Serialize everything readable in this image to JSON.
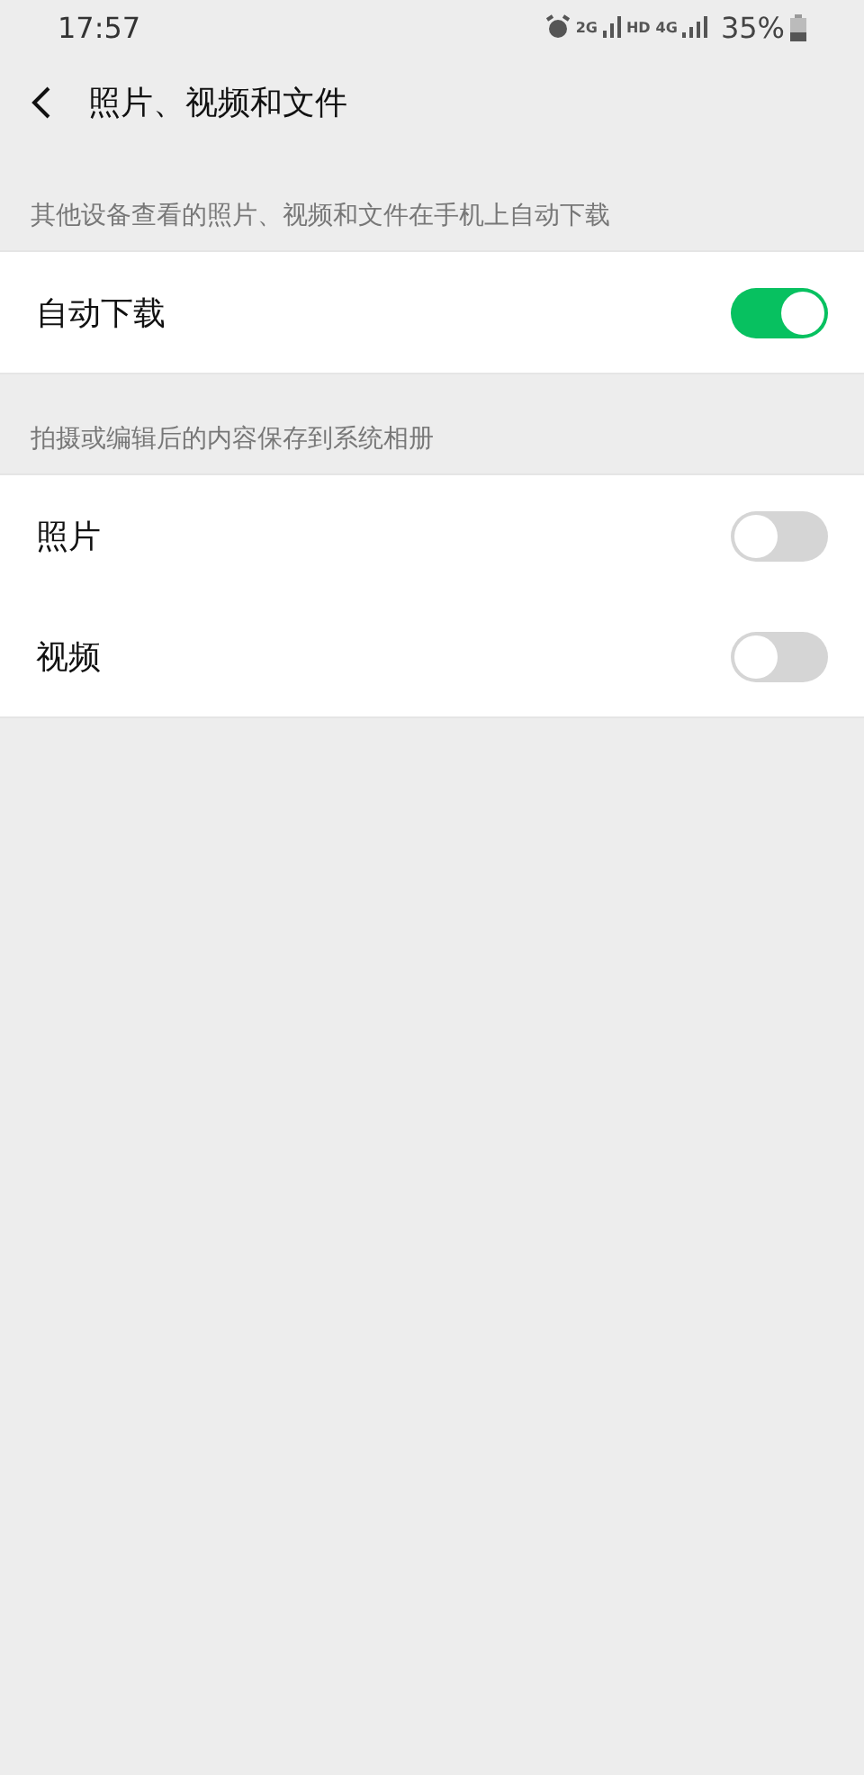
{
  "status_bar": {
    "time": "17:57",
    "network_1": "2G",
    "hd": "HD",
    "network_2": "4G",
    "battery": "35%"
  },
  "header": {
    "title": "照片、视频和文件"
  },
  "sections": [
    {
      "caption": "其他设备查看的照片、视频和文件在手机上自动下载",
      "items": [
        {
          "label": "自动下载",
          "on": true
        }
      ]
    },
    {
      "caption": "拍摄或编辑后的内容保存到系统相册",
      "items": [
        {
          "label": "照片",
          "on": false
        },
        {
          "label": "视频",
          "on": false
        }
      ]
    }
  ]
}
